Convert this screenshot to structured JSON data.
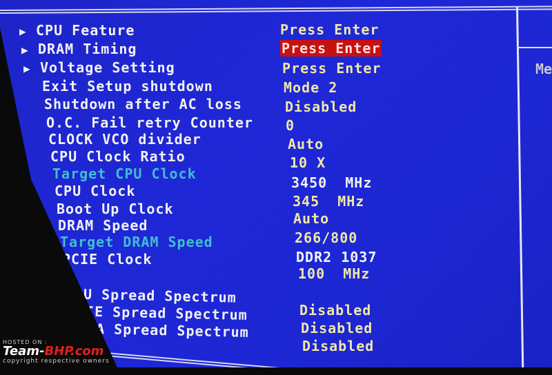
{
  "settings": [
    {
      "label": "CPU Feature",
      "value": "Press Enter",
      "submenu": true,
      "color": "white",
      "value_style": "normal"
    },
    {
      "label": "DRAM Timing",
      "value": "Press Enter",
      "submenu": true,
      "color": "white",
      "value_style": "highlighted"
    },
    {
      "label": "Voltage Setting",
      "value": "Press Enter",
      "submenu": true,
      "color": "white",
      "value_style": "normal"
    },
    {
      "label": "Exit Setup shutdown",
      "value": "Mode 2",
      "submenu": false,
      "color": "white"
    },
    {
      "label": "Shutdown after AC loss",
      "value": "Disabled",
      "submenu": false,
      "color": "white"
    },
    {
      "label": "O.C. Fail retry Counter",
      "value": "0",
      "submenu": false,
      "color": "white"
    },
    {
      "label": "CLOCK VCO divider",
      "value": "Auto",
      "submenu": false,
      "color": "white"
    },
    {
      "label": "CPU Clock Ratio",
      "value": "10 X",
      "submenu": false,
      "color": "white"
    },
    {
      "label": "Target CPU Clock",
      "value": "3450  MHz",
      "submenu": false,
      "color": "cyan"
    },
    {
      "label": "CPU Clock",
      "value": "345  MHz",
      "submenu": false,
      "color": "white"
    },
    {
      "label": "Boot Up Clock",
      "value": "Auto",
      "submenu": false,
      "color": "white"
    },
    {
      "label": "DRAM Speed",
      "value": "266/800",
      "submenu": false,
      "color": "white"
    },
    {
      "label": "Target DRAM Speed",
      "value": "DDR2 1037",
      "submenu": false,
      "color": "cyan"
    },
    {
      "label": "PCIE Clock",
      "value": "100  MHz",
      "submenu": false,
      "color": "white"
    },
    {
      "label": "CPU Spread Spectrum",
      "value": "Disabled",
      "submenu": false,
      "color": "white"
    },
    {
      "label": "PCIE Spread Spectrum",
      "value": "Disabled",
      "submenu": false,
      "color": "white"
    },
    {
      "label": "SATA Spread Spectrum",
      "value": "Disabled",
      "submenu": false,
      "color": "white"
    }
  ],
  "help_panel": {
    "title": "Me"
  },
  "watermark": {
    "hosted": "HOSTED ON :",
    "brand_prefix": "Team-",
    "brand_suffix": "BHP.com",
    "copyright": "copyright respective owners"
  },
  "colors": {
    "background": "#1c25d6",
    "label": "#f2f2f2",
    "label_readonly": "#3fc0d0",
    "value": "#f0e8a8",
    "highlight": "#c81010"
  }
}
